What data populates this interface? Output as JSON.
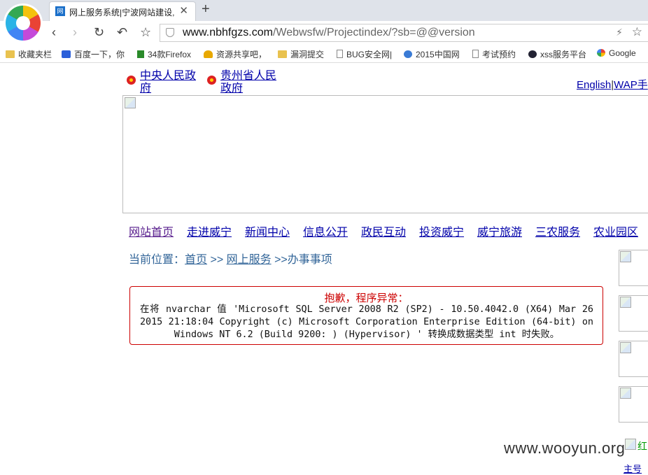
{
  "browser": {
    "tab_title": "网上服务系统|宁波网站建设,",
    "tab_favicon_text": "网",
    "new_tab_symbol": "+",
    "close_symbol": "✕",
    "url_host": "www.nbhfgzs.com",
    "url_path": "/Webwsfw/Projectindex/?sb=@@version",
    "bookmarks": [
      {
        "label": "收藏夹栏",
        "icon": "folder-icon"
      },
      {
        "label": "百度一下，你",
        "icon": "baidu-paw-icon"
      },
      {
        "label": "34款Firefox",
        "icon": "f-logo-icon"
      },
      {
        "label": "资源共享吧，",
        "icon": "trophy-icon"
      },
      {
        "label": "漏洞提交",
        "icon": "folder-icon"
      },
      {
        "label": "BUG安全网|",
        "icon": "document-icon"
      },
      {
        "label": "2015中国网",
        "icon": "anchor-icon"
      },
      {
        "label": "考试预约",
        "icon": "document-icon"
      },
      {
        "label": "xss服务平台",
        "icon": "ghost-icon"
      },
      {
        "label": "Google",
        "icon": "google-icon"
      }
    ]
  },
  "page": {
    "gov_links": [
      "中央人民政府",
      "贵州省人民政府"
    ],
    "lang_links": {
      "english": "English",
      "separator": "|",
      "wap": "WAP手"
    },
    "nav": [
      "网站首页",
      "走进威宁",
      "新闻中心",
      "信息公开",
      "政民互动",
      "投资威宁",
      "威宁旅游",
      "三农服务",
      "农业园区"
    ],
    "breadcrumb": {
      "prefix": "当前位置：",
      "home": "首页",
      "sep1": " >> ",
      "service": "网上服务",
      "sep2": " >>",
      "current": "办事事项"
    },
    "error": {
      "title": "抱歉，程序异常：",
      "message": "在将 nvarchar 值 'Microsoft SQL Server 2008 R2 (SP2) - 10.50.4042.0 (X64) Mar 26 2015 21:18:04 Copyright (c) Microsoft Corporation Enterprise Edition (64-bit) on Windows NT 6.2 (Build 9200: ) (Hypervisor) ' 转换成数据类型 int 时失败。"
    },
    "side_partial_text": "红",
    "bottom_partial_link": "主号"
  },
  "watermark": "www.wooyun.org",
  "colors": {
    "link": "#0000aa",
    "visited": "#551a8b",
    "error": "#cc0000",
    "crumb": "#336699"
  }
}
